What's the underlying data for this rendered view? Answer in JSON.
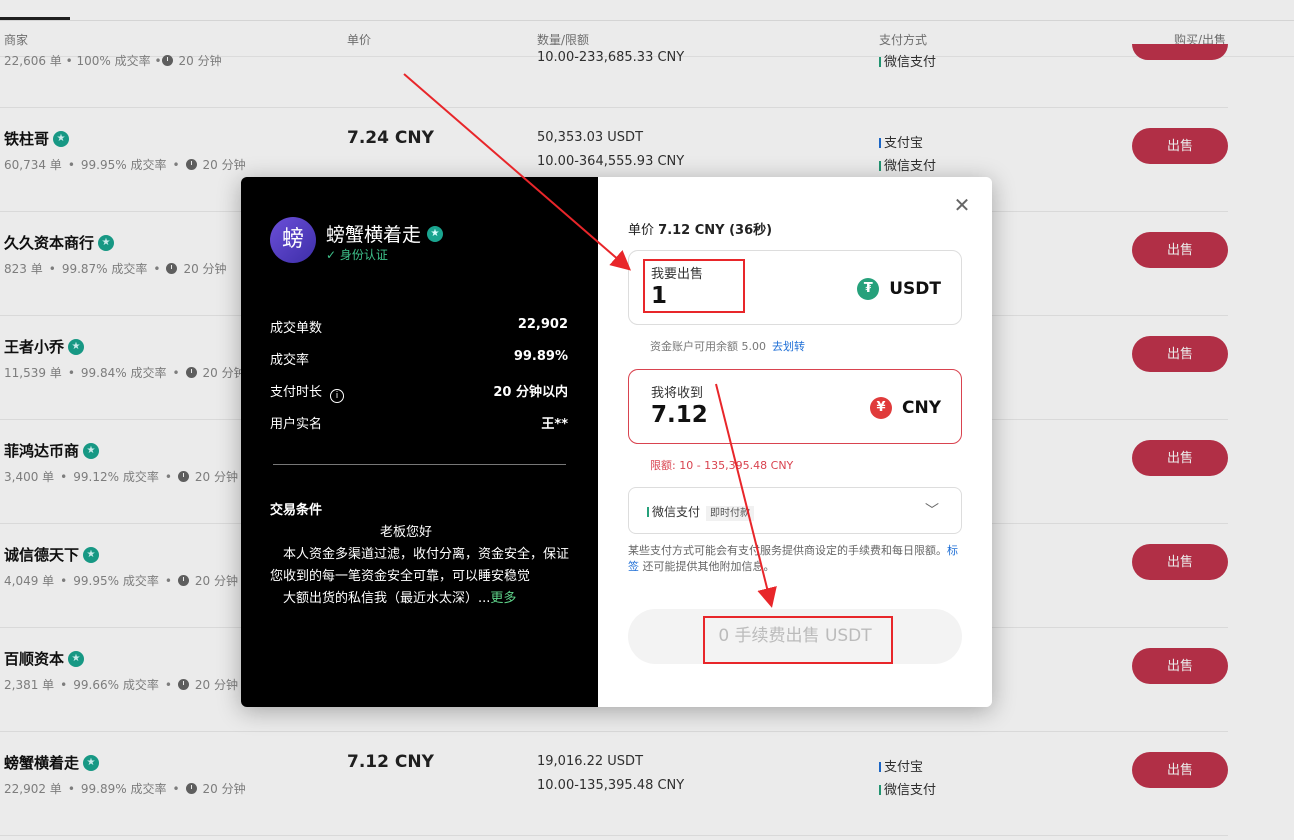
{
  "headers": {
    "merchant": "商家",
    "price": "单价",
    "qty": "数量/限额",
    "payment": "支付方式",
    "action": "购买/出售"
  },
  "top_partial": {
    "stats": "22,606 单 • 100% 成交率 • ",
    "time": "20 分钟",
    "limit": "10.00-233,685.33 CNY",
    "pay": "微信支付"
  },
  "rows": [
    {
      "name": "铁柱哥",
      "orders": "60,734 单",
      "rate": "99.95% 成交率",
      "time": "20 分钟",
      "price": "7.24 CNY",
      "qty": "50,353.03 USDT",
      "limit": "10.00-364,555.93 CNY",
      "pay1": "支付宝",
      "pay2": "微信支付",
      "btn": "出售"
    },
    {
      "name": "久久资本商行",
      "orders": "823 单",
      "rate": "99.87% 成交率",
      "time": "20 分钟",
      "btn": "出售"
    },
    {
      "name": "王者小乔",
      "orders": "11,539 单",
      "rate": "99.84% 成交率",
      "time": "20 分钟",
      "btn": "出售"
    },
    {
      "name": "菲鸿达币商",
      "orders": "3,400 单",
      "rate": "99.12% 成交率",
      "time": "20 分钟",
      "btn": "出售"
    },
    {
      "name": "诚信德天下",
      "orders": "4,049 单",
      "rate": "99.95% 成交率",
      "time": "20 分钟",
      "btn": "出售"
    },
    {
      "name": "百顺资本",
      "orders": "2,381 单",
      "rate": "99.66% 成交率",
      "time": "20 分钟",
      "btn": "出售"
    },
    {
      "name": "螃蟹横着走",
      "orders": "22,902 单",
      "rate": "99.89% 成交率",
      "time": "20 分钟",
      "price": "7.12 CNY",
      "qty": "19,016.22 USDT",
      "limit": "10.00-135,395.48 CNY",
      "pay1": "支付宝",
      "pay2": "微信支付",
      "btn": "出售"
    }
  ],
  "modal": {
    "avatar_char": "螃",
    "seller_name": "螃蟹横着走",
    "verified": "✓ 身份认证",
    "stats": [
      {
        "label": "成交单数",
        "value": "22,902"
      },
      {
        "label": "成交率",
        "value": "99.89%"
      },
      {
        "label": "支付时长",
        "value": "20 分钟以内"
      },
      {
        "label": "用户实名",
        "value": "王**"
      }
    ],
    "terms_title": "交易条件",
    "terms_greeting": "老板您好",
    "terms_line1": "本人资金多渠道过滤，收付分离，资金安全，保证您收到的每一笔资金安全可靠，可以睡安稳觉",
    "terms_line2": "大额出货的私信我（最近水太深）...",
    "terms_more": "更多",
    "unit_price_label": "单价",
    "unit_price_value": "7.12 CNY (36秒)",
    "sell_label": "我要出售",
    "sell_value": "1",
    "sell_currency": "USDT",
    "balance_text": "资金账户可用余额 5.00",
    "balance_link": "去划转",
    "receive_label": "我将收到",
    "receive_value": "7.12",
    "receive_currency": "CNY",
    "limit_text": "限额: 10 - 135,395.48 CNY",
    "pay_method": "微信支付",
    "pay_tag": "即时付款",
    "note_pre": "某些支付方式可能会有支付服务提供商设定的手续费和每日限额。",
    "note_link": "标签",
    "note_post": " 还可能提供其他附加信息。",
    "submit_label": "0 手续费出售 USDT"
  },
  "colors": {
    "sell_button": "#c0344c",
    "badge": "#1aa590",
    "highlight": "#e8262a",
    "link": "#1f6fd6",
    "tether": "#26a17b",
    "yuan": "#e03b3b"
  }
}
